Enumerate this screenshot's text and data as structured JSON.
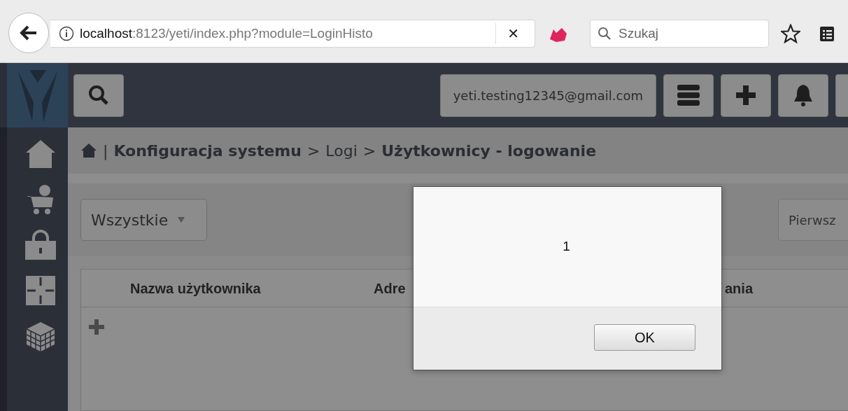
{
  "browser": {
    "url_host": "localhost",
    "url_rest": ":8123/yeti/index.php?module=LoginHisto",
    "close_glyph": "✕",
    "search": {
      "placeholder": "Szukaj"
    }
  },
  "header": {
    "user_email": "yeti.testing12345@gmail.com"
  },
  "breadcrumb": {
    "divider": "|",
    "separator": ">",
    "items": [
      {
        "text": "Konfiguracja systemu",
        "bold": true
      },
      {
        "text": "Logi",
        "bold": false
      },
      {
        "text": "Użytkownicy - logowanie",
        "bold": true
      }
    ]
  },
  "filter": {
    "value": "Wszystkie"
  },
  "pager": {
    "text": "Pierwsz"
  },
  "table": {
    "columns": [
      "Nazwa użytkownika",
      "Adre",
      "ania"
    ]
  },
  "dialog": {
    "message": "1",
    "button": "OK"
  }
}
